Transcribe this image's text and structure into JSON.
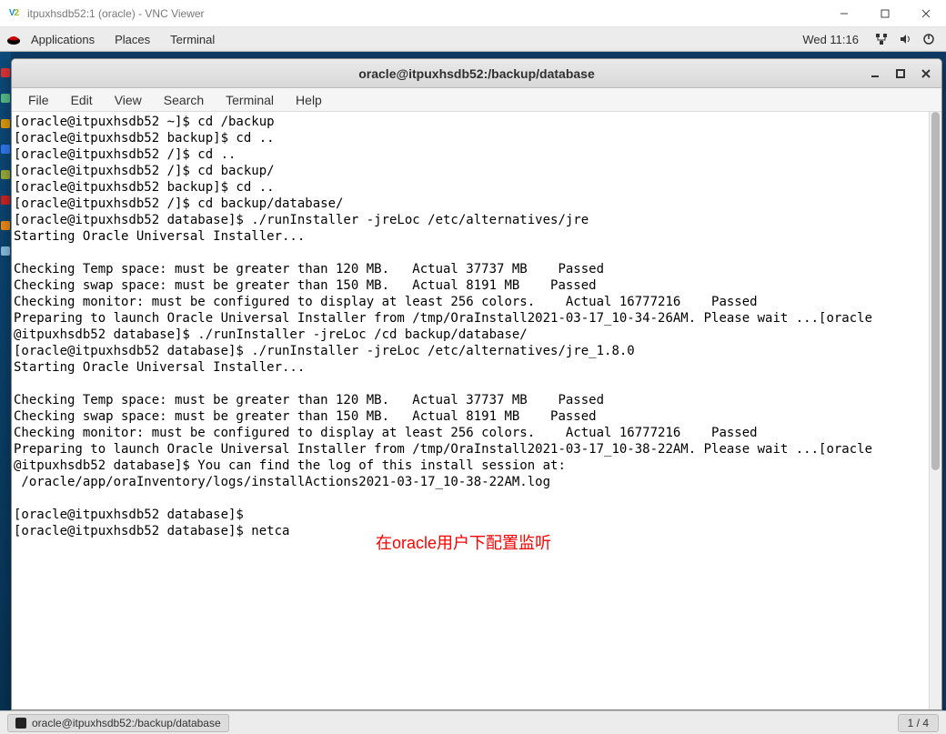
{
  "vnc": {
    "title": "itpuxhsdb52:1 (oracle) - VNC Viewer",
    "logo_chars": [
      "V",
      "2"
    ]
  },
  "gnome": {
    "menu": {
      "applications": "Applications",
      "places": "Places",
      "terminal": "Terminal"
    },
    "clock": "Wed 11:16"
  },
  "terminal": {
    "title": "oracle@itpuxhsdb52:/backup/database",
    "menubar": {
      "file": "File",
      "edit": "Edit",
      "view": "View",
      "search": "Search",
      "terminal": "Terminal",
      "help": "Help"
    },
    "text": "[oracle@itpuxhsdb52 ~]$ cd /backup\n[oracle@itpuxhsdb52 backup]$ cd ..\n[oracle@itpuxhsdb52 /]$ cd ..\n[oracle@itpuxhsdb52 /]$ cd backup/\n[oracle@itpuxhsdb52 backup]$ cd ..\n[oracle@itpuxhsdb52 /]$ cd backup/database/\n[oracle@itpuxhsdb52 database]$ ./runInstaller -jreLoc /etc/alternatives/jre\nStarting Oracle Universal Installer...\n\nChecking Temp space: must be greater than 120 MB.   Actual 37737 MB    Passed\nChecking swap space: must be greater than 150 MB.   Actual 8191 MB    Passed\nChecking monitor: must be configured to display at least 256 colors.    Actual 16777216    Passed\nPreparing to launch Oracle Universal Installer from /tmp/OraInstall2021-03-17_10-34-26AM. Please wait ...[oracle\n@itpuxhsdb52 database]$ ./runInstaller -jreLoc /cd backup/database/\n[oracle@itpuxhsdb52 database]$ ./runInstaller -jreLoc /etc/alternatives/jre_1.8.0\nStarting Oracle Universal Installer...\n\nChecking Temp space: must be greater than 120 MB.   Actual 37737 MB    Passed\nChecking swap space: must be greater than 150 MB.   Actual 8191 MB    Passed\nChecking monitor: must be configured to display at least 256 colors.    Actual 16777216    Passed\nPreparing to launch Oracle Universal Installer from /tmp/OraInstall2021-03-17_10-38-22AM. Please wait ...[oracle\n@itpuxhsdb52 database]$ You can find the log of this install session at:\n /oracle/app/oraInventory/logs/installActions2021-03-17_10-38-22AM.log\n\n[oracle@itpuxhsdb52 database]$\n[oracle@itpuxhsdb52 database]$ netca"
  },
  "annotation": "在oracle用户下配置监听",
  "taskbar": {
    "entry": "oracle@itpuxhsdb52:/backup/database",
    "workspace": "1 / 4"
  }
}
